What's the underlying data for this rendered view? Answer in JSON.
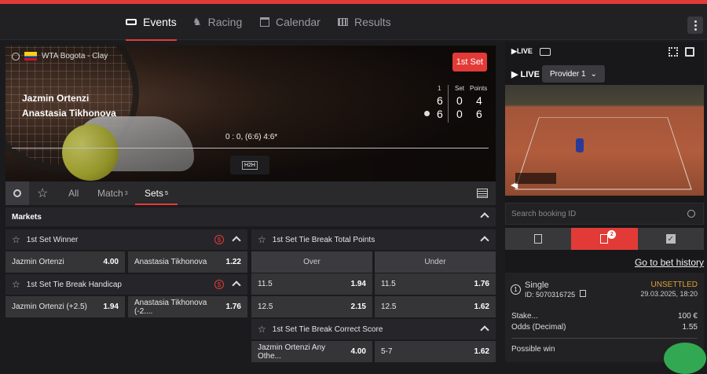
{
  "nav": {
    "items": [
      {
        "label": "Events",
        "icon": "ticket-icon",
        "active": true
      },
      {
        "label": "Racing",
        "icon": "horse-icon"
      },
      {
        "label": "Calendar",
        "icon": "calendar-icon"
      },
      {
        "label": "Results",
        "icon": "results-icon"
      }
    ]
  },
  "match": {
    "tournament": "WTA Bogota - Clay",
    "set_button": "1st Set",
    "player1": "Jazmin Ortenzi",
    "player2": "Anastasia Tikhonova",
    "headers": {
      "set1": "1",
      "set": "Set",
      "points": "Points"
    },
    "p1": {
      "s1": "6",
      "set": "0",
      "points": "4"
    },
    "p2": {
      "s1": "6",
      "set": "0",
      "points": "6"
    },
    "game_state": "0 : 0, (6:6) 4:6*",
    "h2h": "H2H"
  },
  "tabs": {
    "all": "All",
    "match": "Match",
    "match_count": "3",
    "sets": "Sets",
    "sets_count": "5"
  },
  "markets": {
    "title": "Markets",
    "set_winner": {
      "title": "1st Set Winner",
      "p1": "Jazmin Ortenzi",
      "p1_odd": "4.00",
      "p2": "Anastasia Tikhonova",
      "p2_odd": "1.22"
    },
    "tb_handicap": {
      "title": "1st Set Tie Break Handicap",
      "p1": "Jazmin Ortenzi (+2.5)",
      "p1_odd": "1.94",
      "p2": "Anastasia Tikhonova (-2....",
      "p2_odd": "1.76"
    },
    "tb_total": {
      "title": "1st Set Tie Break Total Points",
      "over": "Over",
      "under": "Under",
      "rows": [
        {
          "o_line": "11.5",
          "o_odd": "1.94",
          "u_line": "11.5",
          "u_odd": "1.76"
        },
        {
          "o_line": "12.5",
          "o_odd": "2.15",
          "u_line": "12.5",
          "u_odd": "1.62"
        }
      ]
    },
    "tb_correct": {
      "title": "1st Set Tie Break Correct Score",
      "c1": "Jazmin Ortenzi Any Othe...",
      "c1_odd": "4.00",
      "c2": "5-7",
      "c2_odd": "1.62"
    }
  },
  "stream": {
    "live": "LIVE",
    "provider": "Provider 1"
  },
  "betslip": {
    "search_placeholder": "Search booking ID",
    "badge": "2",
    "history_link": "Go to bet history",
    "type": "Single",
    "id_label": "ID:",
    "id": "5070316725",
    "status": "UNSETTLED",
    "date": "29.03.2025, 18:20",
    "stake_label": "Stake...",
    "stake": "100 €",
    "odds_label": "Odds (Decimal)",
    "odds": "1.55",
    "win_label": "Possible win"
  },
  "colors": {
    "accent": "#e23b37",
    "unsettled": "#e0a030"
  }
}
